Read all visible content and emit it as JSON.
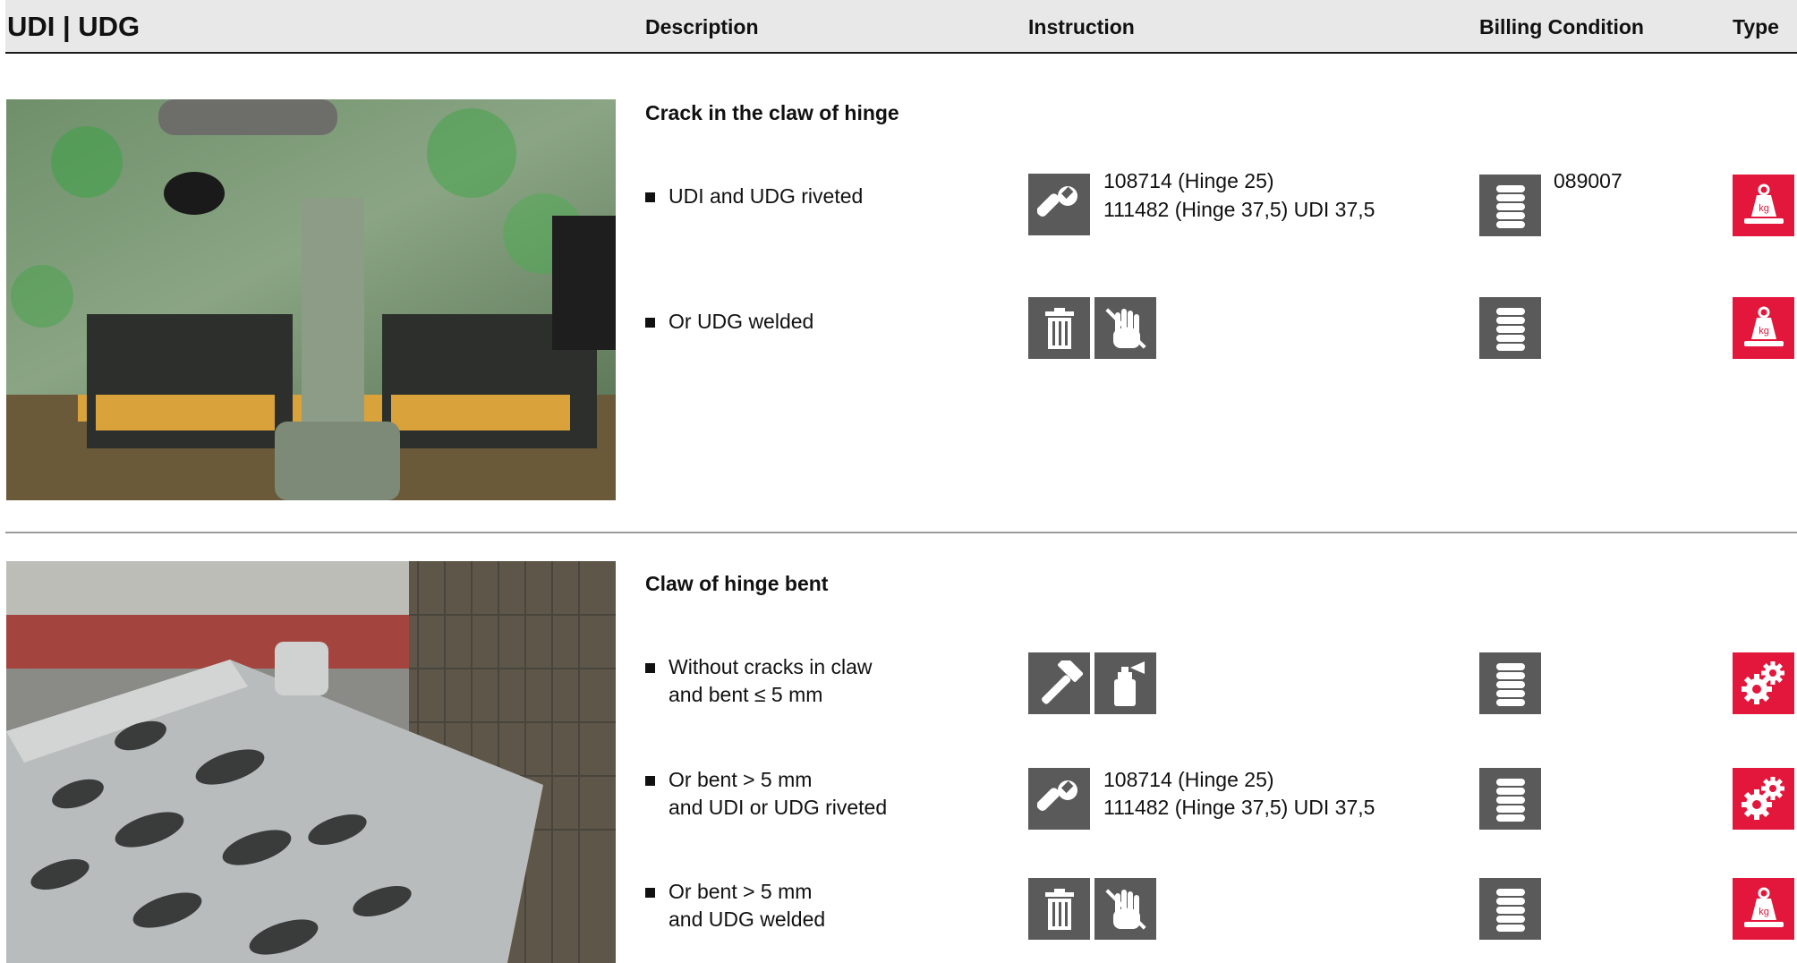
{
  "header": {
    "title": "UDI | UDG",
    "col_description": "Description",
    "col_instruction": "Instruction",
    "col_billing": "Billing Condition",
    "col_type": "Type"
  },
  "sections": [
    {
      "title": "Crack in the claw of hinge",
      "rows": [
        {
          "description": [
            "UDI and UDG riveted"
          ],
          "instruction_icons": [
            "wrench-icon"
          ],
          "instruction_text": [
            "108714 (Hinge 25)",
            "111482 (Hinge 37,5) UDI 37,5"
          ],
          "billing_icon": "coin-stack-icon",
          "billing_text": "089007",
          "type_icon": "weight-kg-icon"
        },
        {
          "description": [
            "Or UDG welded"
          ],
          "instruction_icons": [
            "trash-icon",
            "no-hand-icon"
          ],
          "instruction_text": [],
          "billing_icon": "coin-stack-icon",
          "billing_text": "",
          "type_icon": "weight-kg-icon"
        }
      ]
    },
    {
      "title": "Claw of hinge bent",
      "rows": [
        {
          "description": [
            "Without cracks in claw",
            "and bent ≤ 5 mm"
          ],
          "instruction_icons": [
            "hammer-icon",
            "spray-can-icon"
          ],
          "instruction_text": [],
          "billing_icon": "coin-stack-icon",
          "billing_text": "",
          "type_icon": "gears-icon"
        },
        {
          "description": [
            "Or bent > 5 mm",
            "and UDI or UDG riveted"
          ],
          "instruction_icons": [
            "wrench-icon"
          ],
          "instruction_text": [
            "108714 (Hinge 25)",
            "111482 (Hinge 37,5) UDI 37,5"
          ],
          "billing_icon": "coin-stack-icon",
          "billing_text": "",
          "type_icon": "gears-icon"
        },
        {
          "description": [
            "Or bent > 5 mm",
            "and UDG welded"
          ],
          "instruction_icons": [
            "trash-icon",
            "no-hand-icon"
          ],
          "instruction_text": [],
          "billing_icon": "coin-stack-icon",
          "billing_text": "",
          "type_icon": "weight-kg-icon"
        }
      ]
    }
  ],
  "colors": {
    "icon_gray": "#5a5a5a",
    "type_red": "#e3173c",
    "header_bg": "#e8e8e8"
  }
}
